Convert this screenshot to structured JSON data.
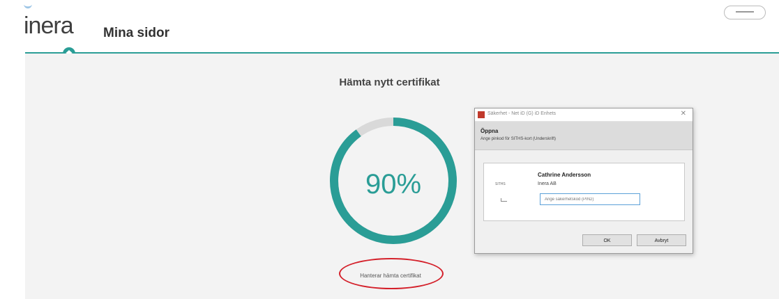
{
  "header": {
    "logo_text": "inera",
    "site_title": "Mina sidor"
  },
  "main": {
    "heading": "Hämta nytt certifikat",
    "progress_label": "90%",
    "progress_fraction": 0.9,
    "status_text": "Hanterar hämta certifikat"
  },
  "dialog": {
    "title": "Säkerhet - Net iD (G) iD Enhets",
    "heading": "Öppna",
    "instruction": "Ange pinkod för SITHS-kort (Underskrift)",
    "card_chip_label": "SITHS",
    "holder_name": "Cathrine Andersson",
    "organization": "Inera AB",
    "pin_placeholder": "Ange säkerhetskod (PIN2)",
    "ok_label": "OK",
    "cancel_label": "Avbryt"
  },
  "colors": {
    "accent": "#2a9d96",
    "progress_track": "#d9d9d9",
    "annotation": "#d4202a",
    "content_background": "#f3f3f3"
  }
}
